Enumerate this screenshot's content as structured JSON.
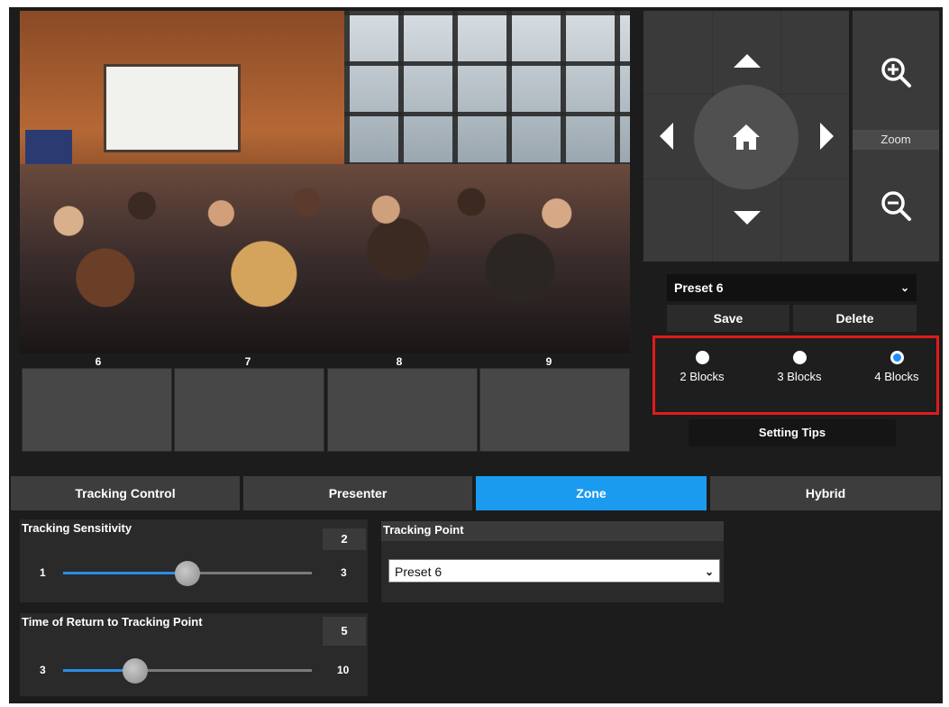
{
  "video": {
    "blocks": [
      {
        "label": "6"
      },
      {
        "label": "7"
      },
      {
        "label": "8"
      },
      {
        "label": "9"
      }
    ]
  },
  "ptz": {
    "zoom_label": "Zoom",
    "icons": [
      "up-arrow-icon",
      "down-arrow-icon",
      "left-arrow-icon",
      "right-arrow-icon",
      "home-icon",
      "zoom-in-icon",
      "zoom-out-icon"
    ]
  },
  "preset": {
    "selected": "Preset 6",
    "save_label": "Save",
    "delete_label": "Delete"
  },
  "blocks_group": {
    "options": [
      {
        "label": "2 Blocks",
        "selected": false
      },
      {
        "label": "3 Blocks",
        "selected": false
      },
      {
        "label": "4 Blocks",
        "selected": true
      }
    ],
    "tips_label": "Setting Tips"
  },
  "tabs": [
    {
      "label": "Tracking Control",
      "active": false
    },
    {
      "label": "Presenter",
      "active": false
    },
    {
      "label": "Zone",
      "active": true
    },
    {
      "label": "Hybrid",
      "active": false
    }
  ],
  "sensitivity": {
    "title": "Tracking Sensitivity",
    "value": "2",
    "min": "1",
    "max": "3",
    "fraction": 0.5
  },
  "return_time": {
    "title": "Time of Return to Tracking Point",
    "value": "5",
    "min": "3",
    "max": "10",
    "fraction": 0.29
  },
  "tracking_point": {
    "title": "Tracking Point",
    "selected": "Preset 6"
  },
  "colors": {
    "accent": "#1a9bf0",
    "highlight_border": "#e01b1b",
    "slider_fill": "#2b8be6"
  }
}
